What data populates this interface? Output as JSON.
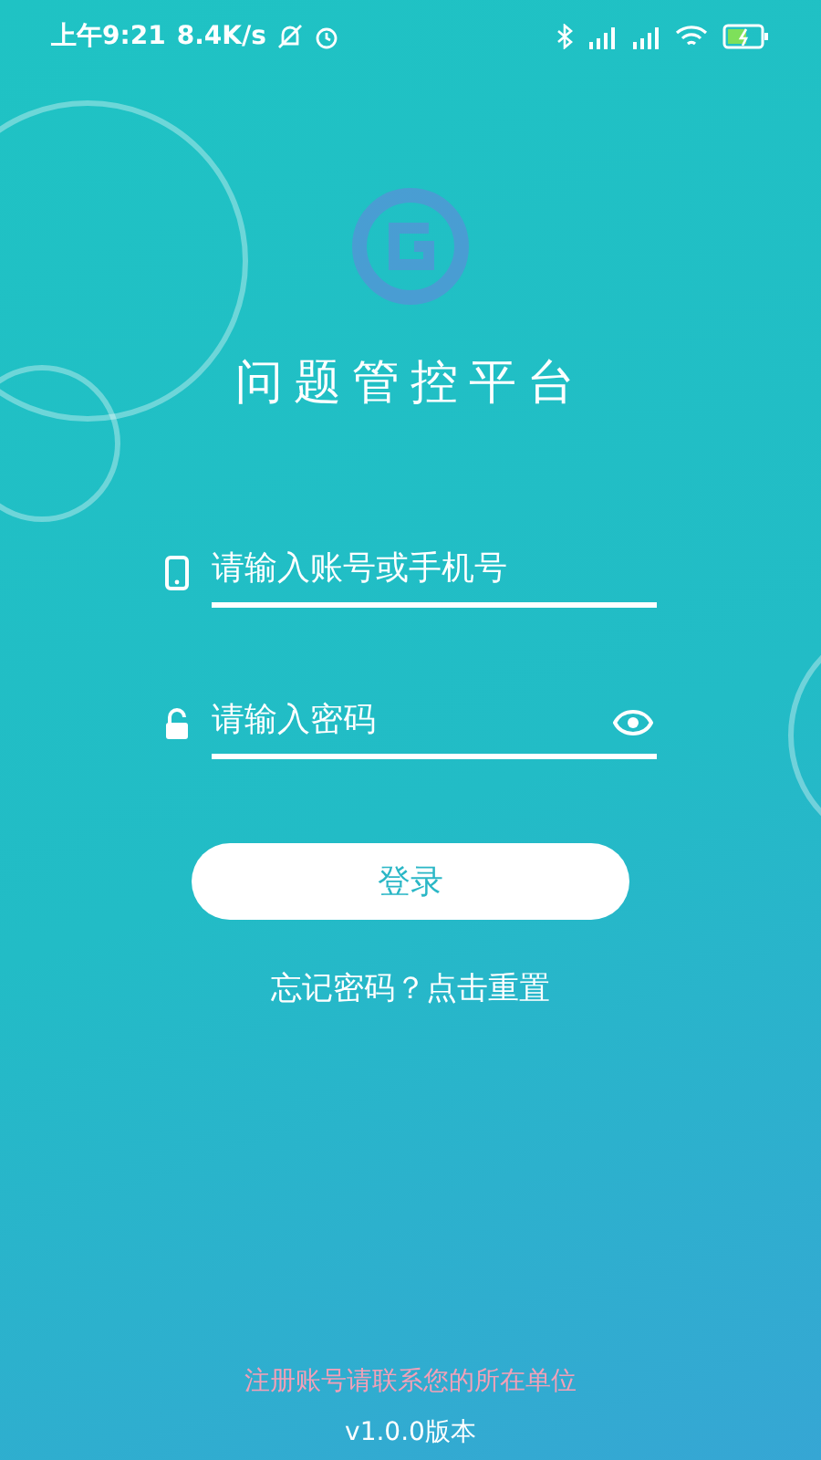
{
  "status_bar": {
    "time": "上午9:21",
    "speed": "8.4K/s"
  },
  "app": {
    "title": "问题管控平台"
  },
  "fields": [
    {
      "kind": "account",
      "placeholder": "请输入账号或手机号"
    },
    {
      "kind": "password",
      "placeholder": "请输入密码"
    }
  ],
  "login_button": "登录",
  "forgot_link": "忘记密码？点击重置",
  "footer": {
    "notice": "注册账号请联系您的所在单位",
    "version": "v1.0.0版本"
  }
}
